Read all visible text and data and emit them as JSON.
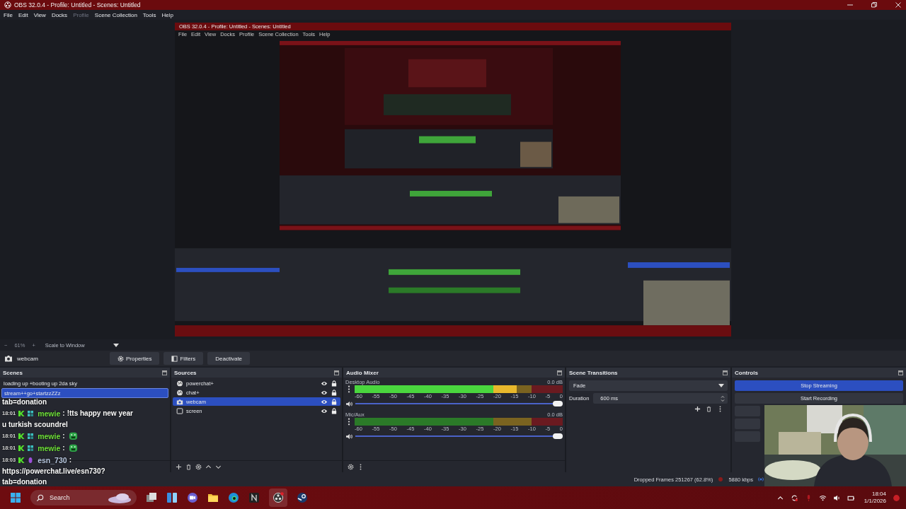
{
  "window": {
    "title": "OBS 32.0.4 - Profile: Untitled - Scenes: Untitled"
  },
  "menu": [
    {
      "label": "File",
      "disabled": false
    },
    {
      "label": "Edit",
      "disabled": false
    },
    {
      "label": "View",
      "disabled": false
    },
    {
      "label": "Docks",
      "disabled": false
    },
    {
      "label": "Profile",
      "disabled": true
    },
    {
      "label": "Scene Collection",
      "disabled": false
    },
    {
      "label": "Tools",
      "disabled": false
    },
    {
      "label": "Help",
      "disabled": false
    }
  ],
  "preview": {
    "title": "OBS 32.0.4 - Profile: Untitled - Scenes: Untitled",
    "menu": [
      "File",
      "Edit",
      "View",
      "Docks",
      "Profile",
      "Scene Collection",
      "Tools",
      "Help"
    ]
  },
  "zoom_bar": {
    "minus": "−",
    "zoom": "61%",
    "plus": "+",
    "scale_mode": "Scale to Window"
  },
  "source_toolbar": {
    "source": "webcam",
    "buttons": [
      {
        "label": "Properties",
        "kind": "gear"
      },
      {
        "label": "Filters",
        "kind": "filter"
      },
      {
        "label": "Deactivate",
        "kind": "plain"
      }
    ]
  },
  "scenes": {
    "title": "Scenes",
    "items": [
      {
        "label": "loading up +booting up 2da sky",
        "selected": false
      },
      {
        "label": "stream++go+startzzZZz",
        "selected": true
      }
    ]
  },
  "chat": {
    "top_fragment": "tab=donation",
    "separator": ":",
    "messages": [
      {
        "time": "18:01",
        "user": "mewie",
        "color": "#6fe03a",
        "kind": "text",
        "inline": "!tts happy new year",
        "lines": [
          "u turkish scoundrel"
        ]
      },
      {
        "time": "18:01",
        "user": "mewie",
        "color": "#6fe03a",
        "kind": "emote"
      },
      {
        "time": "18:01",
        "user": "mewie",
        "color": "#6fe03a",
        "kind": "emote"
      },
      {
        "time": "18:03",
        "user": "esn_730",
        "color": "#b8c8e0",
        "kind": "text",
        "lines": [
          "https://powerchat.live/esn730?",
          "tab=donation"
        ]
      }
    ]
  },
  "sources": {
    "title": "Sources",
    "items": [
      {
        "label": "powerchat+",
        "kind": "browser",
        "visible": true,
        "locked": true,
        "selected": false
      },
      {
        "label": "chat+",
        "kind": "browser",
        "visible": true,
        "locked": true,
        "selected": false
      },
      {
        "label": "webcam",
        "kind": "camera",
        "visible": true,
        "locked": true,
        "selected": true
      },
      {
        "label": "screen",
        "kind": "display",
        "visible": true,
        "locked": true,
        "selected": false
      }
    ]
  },
  "mixer": {
    "title": "Audio Mixer",
    "channels": [
      {
        "name": "Desktop Audio",
        "reading": "0.0 dB",
        "meter": {
          "level": 0.78
        },
        "volume": {
          "level": 1
        },
        "scale": [
          "-60",
          "-55",
          "-50",
          "-45",
          "-40",
          "-35",
          "-30",
          "-25",
          "-20",
          "-15",
          "-10",
          "-5",
          "0"
        ]
      },
      {
        "name": "Mic/Aux",
        "reading": "0.0 dB",
        "meter": {
          "level": 0
        },
        "volume": {
          "level": 1
        },
        "scale": [
          "-60",
          "-55",
          "-50",
          "-45",
          "-40",
          "-35",
          "-30",
          "-25",
          "-20",
          "-15",
          "-10",
          "-5",
          "0"
        ]
      }
    ]
  },
  "transitions": {
    "title": "Scene Transitions",
    "transition": "Fade",
    "duration_label": "Duration",
    "duration": "600 ms"
  },
  "controls": {
    "title": "Controls",
    "buttons": [
      {
        "label": "Stop Streaming",
        "active": true
      },
      {
        "label": "Start Recording",
        "active": false
      }
    ]
  },
  "status_bar": {
    "dropped_frames": "Dropped Frames 251267 (62.8%)",
    "bitrate": "5880 kbps"
  },
  "taskbar": {
    "search": "Search",
    "time": "18:04",
    "date": "1/1/2026"
  }
}
